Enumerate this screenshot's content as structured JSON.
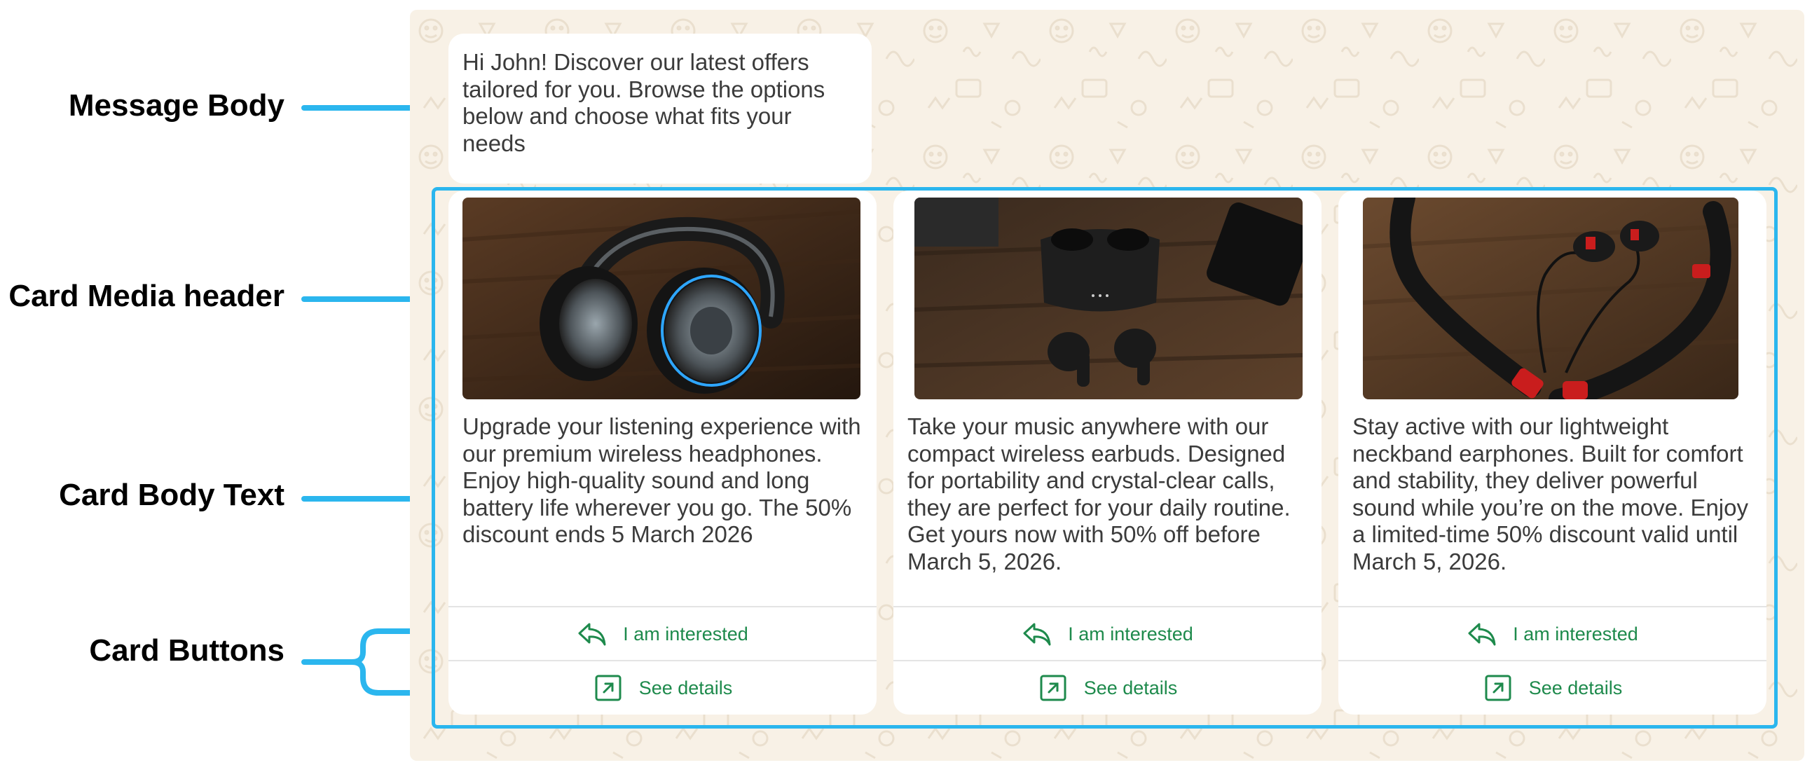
{
  "annotations": {
    "message_body": "Message Body",
    "card_media_header": "Card Media header",
    "card_body_text": "Card Body Text",
    "card_buttons": "Card Buttons"
  },
  "message": {
    "body": "Hi John! Discover our latest offers tailored for you. Browse the options below and choose what fits your needs"
  },
  "cards": [
    {
      "media": "headphones-photo",
      "body": "Upgrade your listening experience with our premium wireless headphones. Enjoy high-quality sound and long battery life wherever you go. The 50% discount ends 5 March 2026",
      "buttons": [
        {
          "label": "I am interested",
          "icon": "reply-icon"
        },
        {
          "label": "See details",
          "icon": "external-link-icon"
        }
      ]
    },
    {
      "media": "earbuds-photo",
      "body": "Take your music anywhere with our compact wireless earbuds. Designed for portability and crystal-clear calls, they are perfect for your daily routine. Get yours now with 50% off before March 5, 2026.",
      "buttons": [
        {
          "label": "I am interested",
          "icon": "reply-icon"
        },
        {
          "label": "See details",
          "icon": "external-link-icon"
        }
      ]
    },
    {
      "media": "neckband-earphones-photo",
      "body": "Stay active with our lightweight neckband earphones. Built for comfort and stability, they deliver powerful sound while you’re on the move. Enjoy a limited-time 50% discount valid until March 5, 2026.",
      "buttons": [
        {
          "label": "I am interested",
          "icon": "reply-icon"
        },
        {
          "label": "See details",
          "icon": "external-link-icon"
        }
      ]
    }
  ],
  "colors": {
    "annotation_accent": "#2bb6ee",
    "button_text": "#1e8a4c",
    "chat_background": "#f8f1e6",
    "card_background": "#ffffff"
  }
}
